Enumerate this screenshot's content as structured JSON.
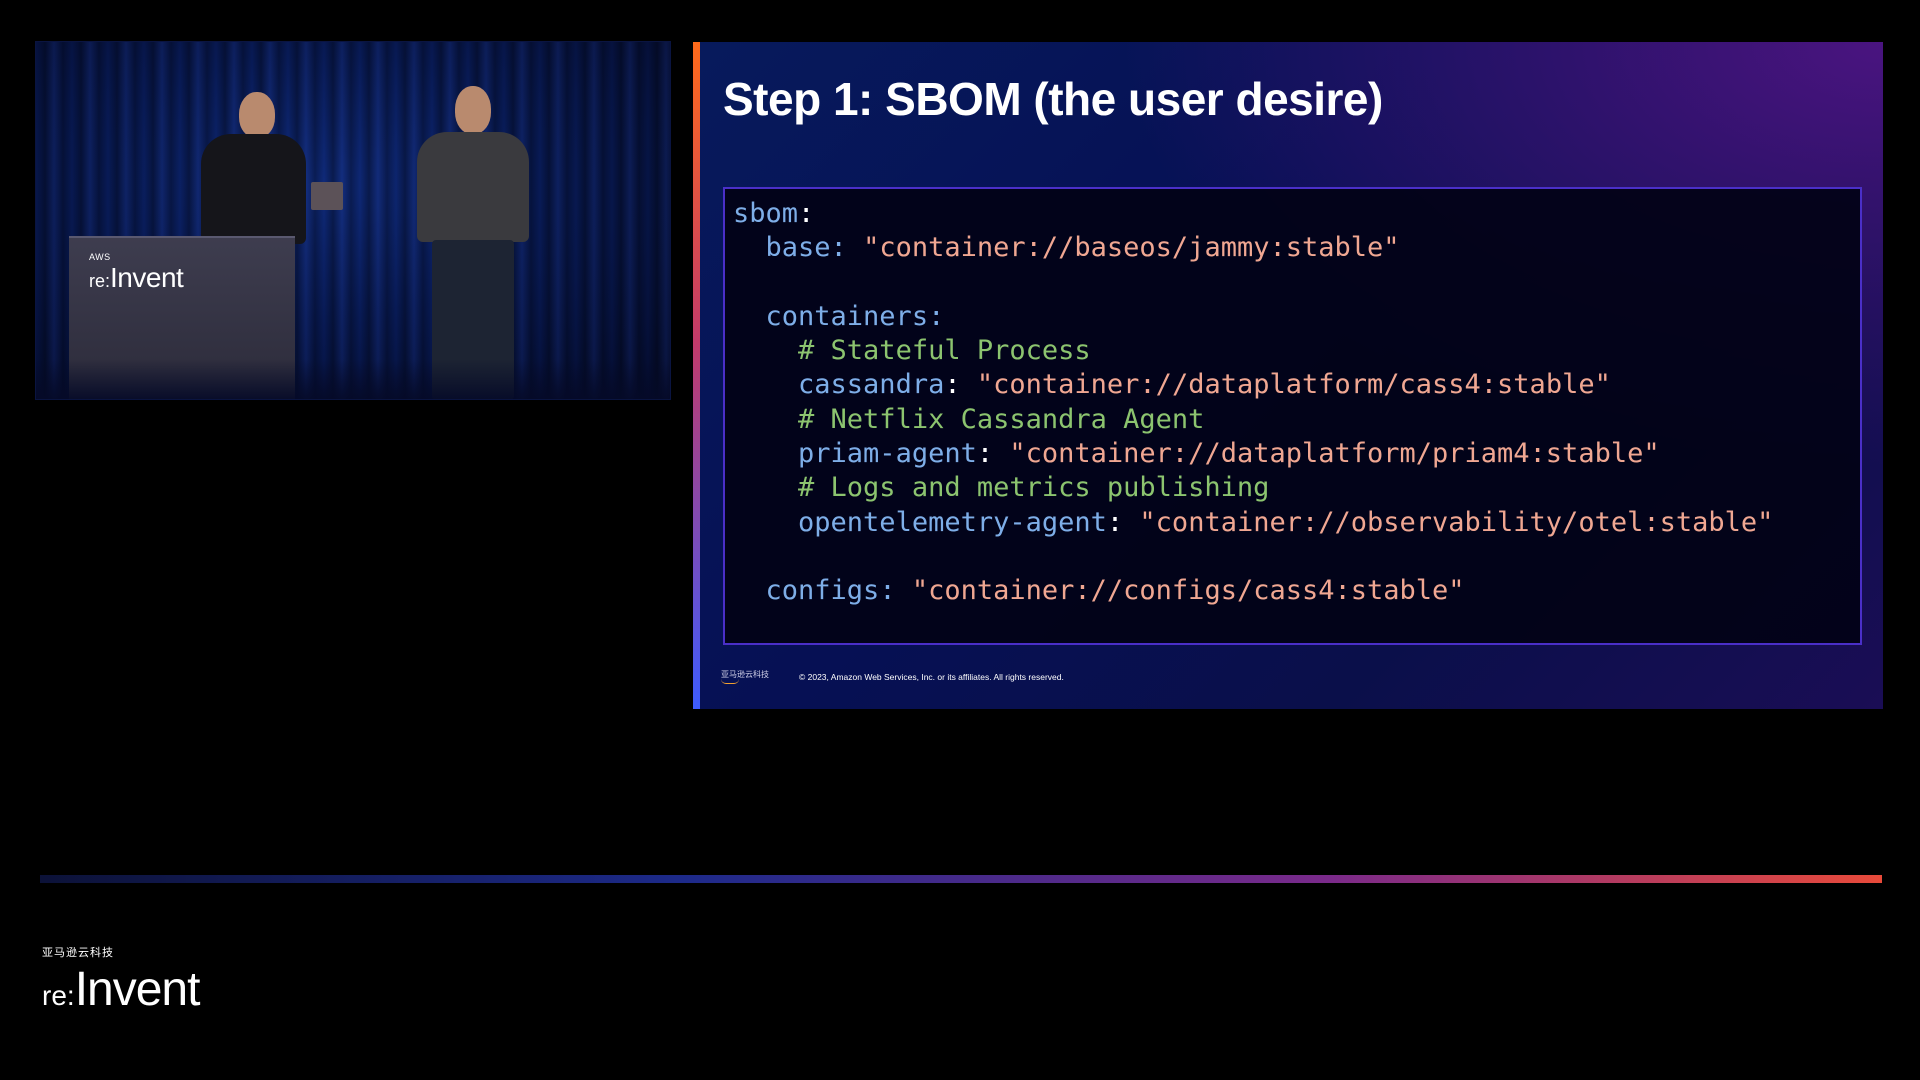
{
  "camera": {
    "podium_logo": {
      "aws": "AWS",
      "re": "re:",
      "invent": "Invent"
    }
  },
  "slide": {
    "title": "Step 1: SBOM (the user desire)",
    "code": {
      "root_key": "sbom",
      "base_key": "base",
      "base_value": "\"container://baseos/jammy:stable\"",
      "containers_key": "containers",
      "comment_1": "# Stateful Process",
      "cassandra_key": "cassandra",
      "cassandra_value": "\"container://dataplatform/cass4:stable\"",
      "comment_2": "# Netflix Cassandra Agent",
      "priam_key": "priam-agent",
      "priam_value": "\"container://dataplatform/priam4:stable\"",
      "comment_3": "# Logs and metrics publishing",
      "otel_key": "opentelemetry-agent",
      "otel_value": "\"container://observability/otel:stable\"",
      "configs_key": "configs",
      "configs_value": "\"container://configs/cass4:stable\""
    },
    "footer": {
      "logo_text": "亚马逊云科技",
      "copyright": "© 2023, Amazon Web Services, Inc. or its affiliates. All rights reserved."
    }
  },
  "brand": {
    "cn": "亚马逊云科技",
    "re": "re:",
    "invent": "Invent"
  },
  "colors": {
    "code_key": "#7eaee8",
    "code_string": "#f0a792",
    "code_comment": "#8cc46f",
    "code_border": "#4a2fc8"
  }
}
